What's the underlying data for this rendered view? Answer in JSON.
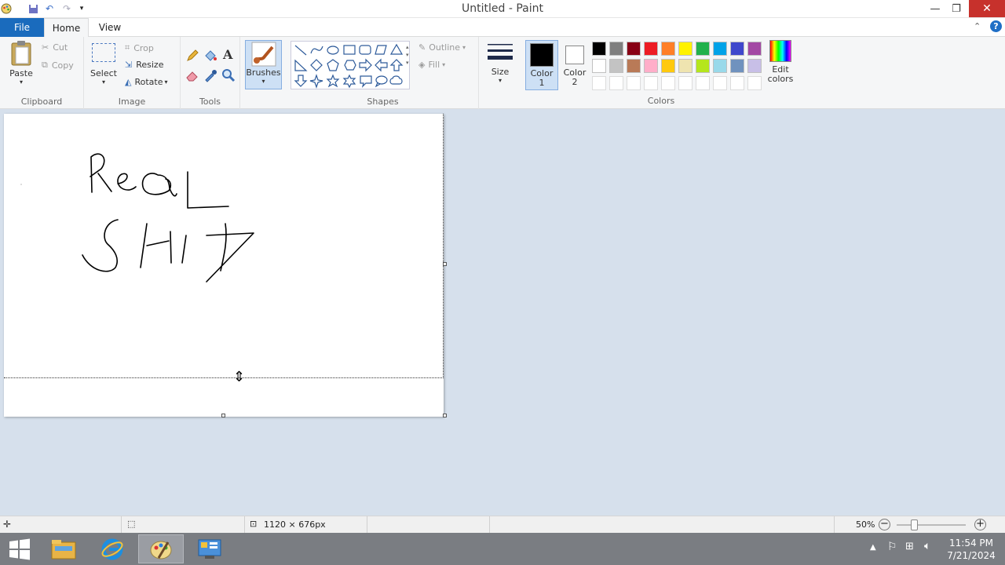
{
  "window": {
    "title": "Untitled - Paint"
  },
  "tabs": {
    "file": "File",
    "home": "Home",
    "view": "View"
  },
  "clipboard": {
    "paste": "Paste",
    "cut": "Cut",
    "copy": "Copy",
    "label": "Clipboard"
  },
  "image": {
    "select": "Select",
    "crop": "Crop",
    "resize": "Resize",
    "rotate": "Rotate",
    "label": "Image"
  },
  "tools": {
    "label": "Tools"
  },
  "brushes": {
    "label": "Brushes"
  },
  "shapes": {
    "outline": "Outline",
    "fill": "Fill",
    "label": "Shapes"
  },
  "size": {
    "label": "Size"
  },
  "colors": {
    "color1": "Color 1",
    "color2": "Color 2",
    "edit": "Edit colors",
    "label": "Colors",
    "color1_value": "#000000",
    "color2_value": "#ffffff",
    "palette_row1": [
      "#000000",
      "#7f7f7f",
      "#880015",
      "#ed1c24",
      "#ff7f27",
      "#fff200",
      "#22b14c",
      "#00a2e8",
      "#3f48cc",
      "#a349a4"
    ],
    "palette_row2": [
      "#ffffff",
      "#c3c3c3",
      "#b97a57",
      "#ffaec9",
      "#ffc90e",
      "#efe4b0",
      "#b5e61d",
      "#99d9ea",
      "#7092be",
      "#c8bfe7"
    ]
  },
  "canvas": {
    "text_line1": "ReaL",
    "text_line2": "SHIT"
  },
  "status": {
    "dimensions": "1120 × 676px",
    "zoom": "50%"
  },
  "taskbar": {
    "time": "11:54 PM",
    "date": "7/21/2024"
  }
}
